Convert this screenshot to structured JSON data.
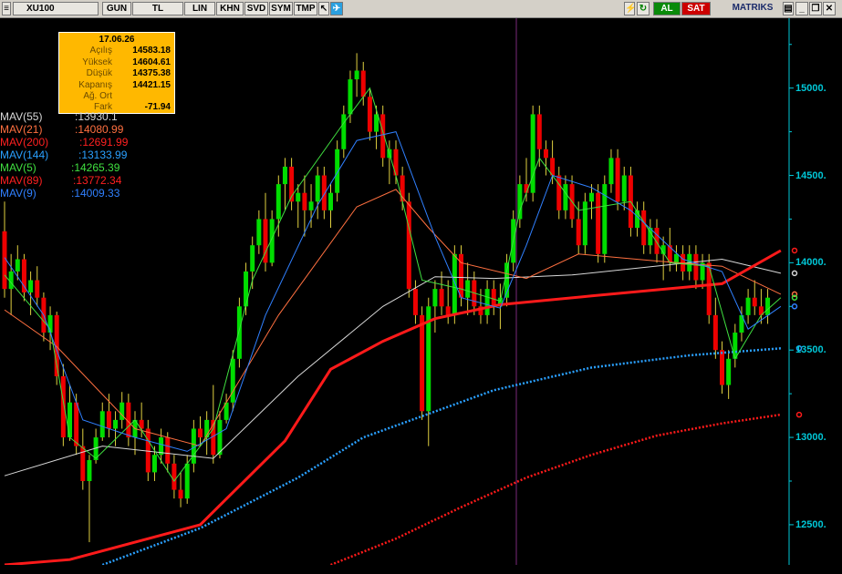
{
  "toolbar": {
    "symbol": "XU100",
    "buttons": [
      "GUN",
      "TL",
      "LIN",
      "KHN",
      "SVD",
      "SYM",
      "TMP"
    ],
    "buy_label": "AL",
    "sell_label": "SAT",
    "brand": "MATRIKS",
    "icons": [
      "pointer-icon",
      "twitter-icon",
      "lightning-icon",
      "refresh-icon",
      "notes-icon",
      "minimize-icon",
      "restore-icon",
      "close-icon"
    ]
  },
  "ohlc_box": {
    "date": "17.06.26",
    "rows": [
      {
        "label": "Açılış",
        "value": "14583.18"
      },
      {
        "label": "Yüksek",
        "value": "14604.61"
      },
      {
        "label": "Düşük",
        "value": "14375.38"
      },
      {
        "label": "Kapanış",
        "value": "14421.15"
      },
      {
        "label": "Ağ. Ort",
        "value": ""
      },
      {
        "label": "Fark",
        "value": "-71.94"
      }
    ]
  },
  "legend": [
    {
      "name": "MAV(55)",
      "value": ":13930.1",
      "color": "#d8d8d8"
    },
    {
      "name": "MAV(21)",
      "value": ":14080.99",
      "color": "#ff7040"
    },
    {
      "name": "MAV(200)",
      "value": ":12691.99",
      "color": "#ff2020"
    },
    {
      "name": "MAV(144)",
      "value": ":13133.99",
      "color": "#2aa0ff"
    },
    {
      "name": "MAV(5)",
      "value": ":14265.39",
      "color": "#40e040"
    },
    {
      "name": "MAV(89)",
      "value": ":13772.34",
      "color": "#ff2020"
    },
    {
      "name": "MAV(9)",
      "value": ":14009.33",
      "color": "#3080ff"
    }
  ],
  "colors": {
    "up": "#00dd00",
    "down": "#ee0000",
    "axis": "#00c8d8",
    "background": "#000000",
    "ohlc_box": "#ffb800",
    "wick": "#e0d040",
    "cursor_line": "#7a2a7a"
  },
  "chart_data": {
    "type": "candlestick",
    "ylim": [
      12270,
      15400
    ],
    "y_ticks": [
      12500,
      13000,
      13500,
      14000,
      14500,
      15000
    ],
    "y_tick_labels": [
      "12500.",
      "13000.",
      "13500.",
      "14000.",
      "14500.",
      "15000."
    ],
    "candles": [
      [
        14180,
        14350,
        13800,
        13850
      ],
      [
        13850,
        14050,
        13700,
        13950
      ],
      [
        13950,
        14100,
        13900,
        14020
      ],
      [
        14020,
        14050,
        13780,
        13830
      ],
      [
        13830,
        13950,
        13700,
        13900
      ],
      [
        13900,
        13980,
        13750,
        13800
      ],
      [
        13800,
        13830,
        13550,
        13600
      ],
      [
        13600,
        13750,
        13500,
        13700
      ],
      [
        13700,
        13720,
        13300,
        13350
      ],
      [
        13350,
        13420,
        12950,
        13000
      ],
      [
        13000,
        13300,
        12980,
        13200
      ],
      [
        13200,
        13250,
        12900,
        12950
      ],
      [
        12950,
        13050,
        12700,
        12750
      ],
      [
        12750,
        12900,
        12400,
        12870
      ],
      [
        12870,
        13050,
        12850,
        13000
      ],
      [
        13000,
        13200,
        12980,
        13150
      ],
      [
        13150,
        13250,
        13000,
        13050
      ],
      [
        13050,
        13150,
        12950,
        13100
      ],
      [
        13100,
        13260,
        13050,
        13200
      ],
      [
        13200,
        13250,
        12950,
        13000
      ],
      [
        13000,
        13150,
        12900,
        13100
      ],
      [
        13100,
        13200,
        13000,
        13050
      ],
      [
        13050,
        13100,
        12750,
        12800
      ],
      [
        12800,
        12950,
        12750,
        12900
      ],
      [
        12900,
        13050,
        12850,
        13000
      ],
      [
        13000,
        13030,
        12800,
        12850
      ],
      [
        12850,
        12900,
        12650,
        12700
      ],
      [
        12700,
        12800,
        12600,
        12650
      ],
      [
        12650,
        12900,
        12620,
        12850
      ],
      [
        12850,
        13100,
        12800,
        13050
      ],
      [
        13050,
        13120,
        12950,
        13000
      ],
      [
        13000,
        13150,
        12900,
        13100
      ],
      [
        13100,
        13300,
        12850,
        12900
      ],
      [
        12900,
        13150,
        12880,
        13100
      ],
      [
        13100,
        13250,
        13080,
        13200
      ],
      [
        13200,
        13500,
        13150,
        13450
      ],
      [
        13450,
        13800,
        13400,
        13750
      ],
      [
        13750,
        14000,
        13700,
        13950
      ],
      [
        13950,
        14150,
        13850,
        14100
      ],
      [
        14100,
        14300,
        14050,
        14250
      ],
      [
        14250,
        14400,
        13950,
        14000
      ],
      [
        14000,
        14300,
        13980,
        14250
      ],
      [
        14250,
        14500,
        14150,
        14450
      ],
      [
        14450,
        14600,
        14300,
        14550
      ],
      [
        14550,
        14600,
        14300,
        14350
      ],
      [
        14350,
        14450,
        14200,
        14400
      ],
      [
        14400,
        14500,
        14150,
        14300
      ],
      [
        14300,
        14450,
        14200,
        14350
      ],
      [
        14350,
        14550,
        14250,
        14500
      ],
      [
        14500,
        14550,
        14250,
        14300
      ],
      [
        14300,
        14450,
        14200,
        14400
      ],
      [
        14400,
        14700,
        14350,
        14650
      ],
      [
        14650,
        14900,
        14600,
        14850
      ],
      [
        14850,
        15100,
        14800,
        15050
      ],
      [
        15050,
        15200,
        14950,
        15100
      ],
      [
        15100,
        15150,
        14900,
        14950
      ],
      [
        14950,
        15000,
        14700,
        14750
      ],
      [
        14750,
        14900,
        14650,
        14850
      ],
      [
        14850,
        14900,
        14550,
        14600
      ],
      [
        14600,
        14700,
        14450,
        14650
      ],
      [
        14650,
        14700,
        14450,
        14500
      ],
      [
        14500,
        14550,
        14300,
        14350
      ],
      [
        14350,
        14400,
        13800,
        13850
      ],
      [
        13850,
        13900,
        13650,
        13700
      ],
      [
        13700,
        13750,
        13100,
        13150
      ],
      [
        13150,
        13800,
        12950,
        13750
      ],
      [
        13750,
        13900,
        13600,
        13850
      ],
      [
        13850,
        13950,
        13700,
        13750
      ],
      [
        13750,
        13900,
        13650,
        13700
      ],
      [
        13700,
        14100,
        13650,
        14050
      ],
      [
        14050,
        14100,
        13750,
        13800
      ],
      [
        13800,
        14000,
        13700,
        13900
      ],
      [
        13900,
        13950,
        13700,
        13750
      ],
      [
        13750,
        13850,
        13650,
        13700
      ],
      [
        13700,
        13900,
        13650,
        13850
      ],
      [
        13850,
        13900,
        13700,
        13750
      ],
      [
        13750,
        13880,
        13620,
        13800
      ],
      [
        13800,
        14050,
        13750,
        14000
      ],
      [
        14000,
        14300,
        13950,
        14250
      ],
      [
        14250,
        14500,
        14200,
        14450
      ],
      [
        14450,
        14600,
        14350,
        14400
      ],
      [
        14400,
        14900,
        14350,
        14850
      ],
      [
        14850,
        14900,
        14550,
        14650
      ],
      [
        14650,
        14700,
        14500,
        14600
      ],
      [
        14600,
        14700,
        14450,
        14500
      ],
      [
        14500,
        14550,
        14250,
        14300
      ],
      [
        14300,
        14500,
        14250,
        14450
      ],
      [
        14450,
        14500,
        14200,
        14250
      ],
      [
        14250,
        14350,
        14050,
        14100
      ],
      [
        14100,
        14400,
        14050,
        14350
      ],
      [
        14350,
        14450,
        14250,
        14400
      ],
      [
        14400,
        14450,
        14000,
        14050
      ],
      [
        14050,
        14500,
        14000,
        14450
      ],
      [
        14450,
        14650,
        14400,
        14600
      ],
      [
        14600,
        14650,
        14300,
        14350
      ],
      [
        14350,
        14550,
        14300,
        14500
      ],
      [
        14500,
        14550,
        14150,
        14200
      ],
      [
        14200,
        14350,
        14150,
        14300
      ],
      [
        14300,
        14350,
        14050,
        14100
      ],
      [
        14100,
        14250,
        14050,
        14200
      ],
      [
        14200,
        14250,
        14000,
        14050
      ],
      [
        14050,
        14150,
        13900,
        14100
      ],
      [
        14100,
        14200,
        13950,
        14000
      ],
      [
        14000,
        14100,
        13950,
        14050
      ],
      [
        14050,
        14100,
        13900,
        13950
      ],
      [
        13950,
        14100,
        13900,
        14050
      ],
      [
        14050,
        14100,
        13850,
        13900
      ],
      [
        13900,
        14050,
        13850,
        14000
      ],
      [
        14000,
        14050,
        13650,
        13700
      ],
      [
        13700,
        13800,
        13450,
        13500
      ],
      [
        13500,
        13550,
        13250,
        13300
      ],
      [
        13300,
        13500,
        13220,
        13450
      ],
      [
        13450,
        13650,
        13400,
        13600
      ],
      [
        13600,
        13750,
        13550,
        13700
      ],
      [
        13700,
        13850,
        13650,
        13800
      ],
      [
        13800,
        13900,
        13700,
        13750
      ],
      [
        13750,
        13850,
        13650,
        13700
      ],
      [
        13700,
        13850,
        13650,
        13800
      ]
    ],
    "series": [
      {
        "name": "MAV(55)",
        "values": [
          [
            0,
            12780
          ],
          [
            15,
            12950
          ],
          [
            32,
            12880
          ],
          [
            45,
            13350
          ],
          [
            58,
            13750
          ],
          [
            66,
            13920
          ],
          [
            75,
            13910
          ],
          [
            87,
            13930
          ],
          [
            110,
            14020
          ],
          [
            119,
            13940
          ]
        ]
      },
      {
        "name": "MAV(21)",
        "values": [
          [
            0,
            13730
          ],
          [
            8,
            13520
          ],
          [
            20,
            13050
          ],
          [
            30,
            12950
          ],
          [
            42,
            13700
          ],
          [
            54,
            14320
          ],
          [
            60,
            14420
          ],
          [
            65,
            14200
          ],
          [
            70,
            14000
          ],
          [
            80,
            13910
          ],
          [
            88,
            14050
          ],
          [
            100,
            14010
          ],
          [
            110,
            13980
          ],
          [
            119,
            13820
          ]
        ]
      },
      {
        "name": "MAV(200)",
        "values": [
          [
            0,
            12270
          ],
          [
            10,
            12300
          ],
          [
            30,
            12500
          ],
          [
            43,
            12980
          ],
          [
            50,
            13390
          ],
          [
            58,
            13550
          ],
          [
            66,
            13680
          ],
          [
            76,
            13760
          ],
          [
            90,
            13810
          ],
          [
            110,
            13880
          ],
          [
            119,
            14070
          ]
        ]
      },
      {
        "name": "MAV(144)",
        "values": [
          [
            15,
            12270
          ],
          [
            30,
            12480
          ],
          [
            45,
            12770
          ],
          [
            55,
            13000
          ],
          [
            75,
            13270
          ],
          [
            90,
            13400
          ],
          [
            105,
            13470
          ],
          [
            119,
            13510
          ]
        ]
      },
      {
        "name": "MAV(5)",
        "values": [
          [
            0,
            13930
          ],
          [
            7,
            13620
          ],
          [
            10,
            13000
          ],
          [
            14,
            12880
          ],
          [
            20,
            13100
          ],
          [
            26,
            12750
          ],
          [
            32,
            13050
          ],
          [
            38,
            13900
          ],
          [
            44,
            14380
          ],
          [
            52,
            14800
          ],
          [
            56,
            15000
          ],
          [
            60,
            14500
          ],
          [
            64,
            13900
          ],
          [
            70,
            13850
          ],
          [
            76,
            13780
          ],
          [
            79,
            14300
          ],
          [
            82,
            14600
          ],
          [
            88,
            14300
          ],
          [
            96,
            14350
          ],
          [
            102,
            14000
          ],
          [
            108,
            13980
          ],
          [
            112,
            13450
          ],
          [
            116,
            13700
          ],
          [
            119,
            13800
          ]
        ]
      },
      {
        "name": "MAV(89)",
        "values": [
          [
            50,
            12270
          ],
          [
            60,
            12420
          ],
          [
            70,
            12600
          ],
          [
            80,
            12770
          ],
          [
            90,
            12900
          ],
          [
            100,
            13010
          ],
          [
            110,
            13080
          ],
          [
            119,
            13130
          ]
        ]
      },
      {
        "name": "MAV(9)",
        "values": [
          [
            0,
            14030
          ],
          [
            6,
            13700
          ],
          [
            12,
            13100
          ],
          [
            20,
            13000
          ],
          [
            28,
            12920
          ],
          [
            34,
            13050
          ],
          [
            40,
            13700
          ],
          [
            48,
            14330
          ],
          [
            54,
            14700
          ],
          [
            60,
            14750
          ],
          [
            66,
            14150
          ],
          [
            70,
            13800
          ],
          [
            76,
            13740
          ],
          [
            80,
            14100
          ],
          [
            84,
            14500
          ],
          [
            90,
            14430
          ],
          [
            96,
            14300
          ],
          [
            104,
            14020
          ],
          [
            110,
            13950
          ],
          [
            114,
            13620
          ],
          [
            119,
            13750
          ]
        ]
      }
    ]
  }
}
